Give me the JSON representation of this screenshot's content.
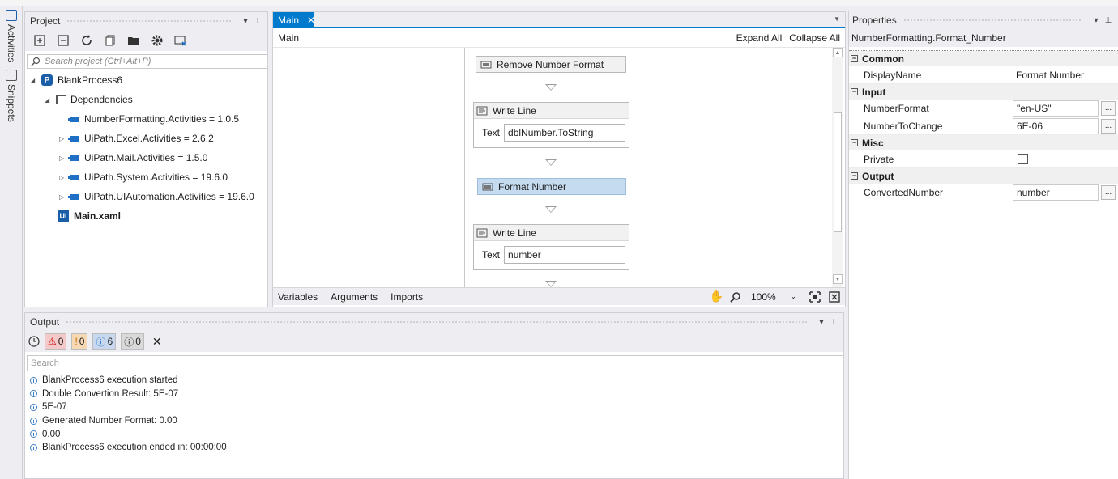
{
  "left_strip": {
    "activities": "Activities",
    "snippets": "Snippets"
  },
  "project": {
    "title": "Project",
    "search_placeholder": "Search project (Ctrl+Alt+P)",
    "tree": {
      "root": "BlankProcess6",
      "dependencies": "Dependencies",
      "deps": [
        "NumberFormatting.Activities = 1.0.5",
        "UiPath.Excel.Activities = 2.6.2",
        "UiPath.Mail.Activities = 1.5.0",
        "UiPath.System.Activities = 19.6.0",
        "UiPath.UIAutomation.Activities = 19.6.0"
      ],
      "main_file": "Main.xaml"
    }
  },
  "designer": {
    "tab_label": "Main",
    "breadcrumb": "Main",
    "expand_all": "Expand All",
    "collapse_all": "Collapse All",
    "activities": {
      "remove_number_format": "Remove Number Format",
      "write_line_1": {
        "title": "Write Line",
        "text_label": "Text",
        "value": "dblNumber.ToString"
      },
      "format_number": "Format Number",
      "write_line_2": {
        "title": "Write Line",
        "text_label": "Text",
        "value": "number"
      }
    },
    "bottom": {
      "variables": "Variables",
      "arguments": "Arguments",
      "imports": "Imports",
      "zoom": "100%"
    }
  },
  "properties": {
    "title": "Properties",
    "selected": "NumberFormatting.Format_Number",
    "categories": {
      "common": "Common",
      "input": "Input",
      "misc": "Misc",
      "output": "Output"
    },
    "fields": {
      "display_name": {
        "name": "DisplayName",
        "value": "Format Number"
      },
      "number_format": {
        "name": "NumberFormat",
        "value": "\"en-US\""
      },
      "number_to_change": {
        "name": "NumberToChange",
        "value": "6E-06"
      },
      "private": {
        "name": "Private"
      },
      "converted_number": {
        "name": "ConvertedNumber",
        "value": "number"
      }
    },
    "ellipsis": "..."
  },
  "output": {
    "title": "Output",
    "counts": {
      "errors": "0",
      "warnings": "0",
      "info": "6",
      "trace": "0"
    },
    "search_placeholder": "Search",
    "lines": [
      "BlankProcess6 execution started",
      "Double Convertion Result: 5E-07",
      "5E-07",
      "Generated Number Format: 0.00",
      "0.00",
      "BlankProcess6 execution ended in: 00:00:00"
    ]
  }
}
